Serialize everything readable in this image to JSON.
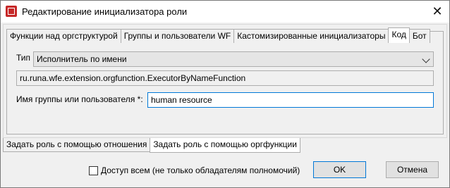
{
  "window": {
    "title": "Редактирование инициализатора роли"
  },
  "inner_tabs": [
    {
      "label": "Функции над оргструктурой",
      "active": false
    },
    {
      "label": "Группы и пользователи WF",
      "active": false
    },
    {
      "label": "Кастомизированные инициализаторы",
      "active": false
    },
    {
      "label": "Код",
      "active": true
    },
    {
      "label": "Бот",
      "active": false
    }
  ],
  "form": {
    "type_label": "Тип",
    "type_value": "Исполнитель по имени",
    "class_value": "ru.runa.wfe.extension.orgfunction.ExecutorByNameFunction",
    "name_label": "Имя группы или пользователя *:",
    "name_value": "human resource"
  },
  "outer_tabs": [
    {
      "label": "Задать роль с помощью отношения",
      "active": false
    },
    {
      "label": "Задать роль с помощью оргфункции",
      "active": true
    }
  ],
  "footer": {
    "checkbox_label": "Доступ всем (не только обладателям полномочий)",
    "ok_label": "OK",
    "cancel_label": "Отмена"
  }
}
